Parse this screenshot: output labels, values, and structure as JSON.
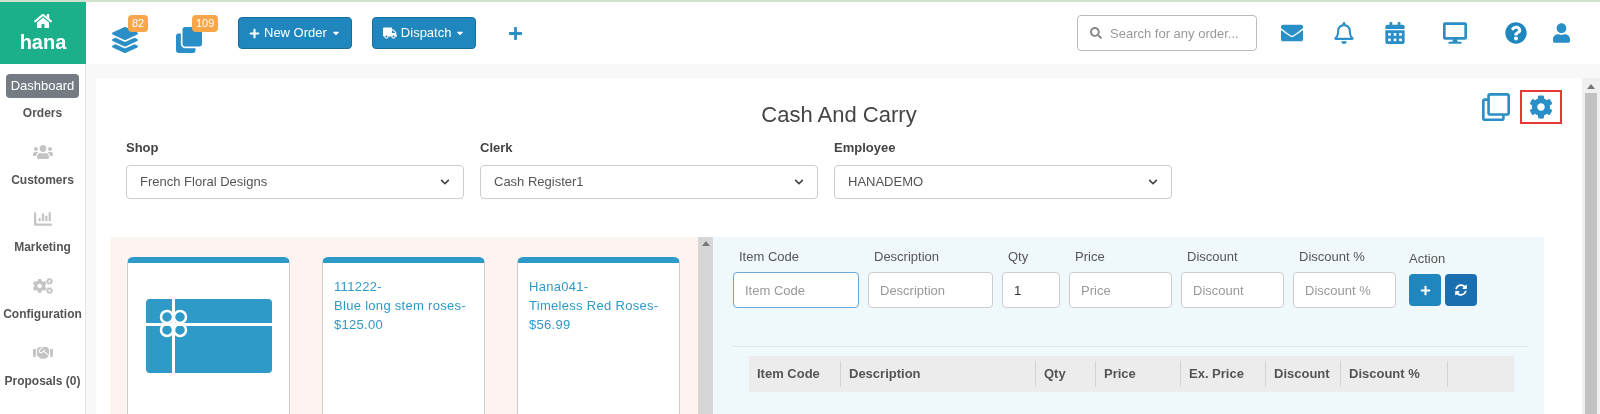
{
  "logo": {
    "text": "hana"
  },
  "tooltip": "Dashboard",
  "sidebar": {
    "items": [
      {
        "label": "Orders"
      },
      {
        "label": "Customers"
      },
      {
        "label": "Marketing"
      },
      {
        "label": "Configuration"
      },
      {
        "label": "Proposals (0)"
      }
    ]
  },
  "toolbar": {
    "badges": [
      "82",
      "109"
    ],
    "buttons": [
      "New Order",
      "Dispatch"
    ],
    "search": {
      "placeholder": "Search for any order..."
    }
  },
  "page": {
    "title": "Cash And Carry",
    "settings_highlighted": true,
    "selects": [
      {
        "label": "Shop",
        "value": "French Floral Designs"
      },
      {
        "label": "Clerk",
        "value": "Cash Register1"
      },
      {
        "label": "Employee",
        "value": "HANADEMO"
      }
    ]
  },
  "products": [
    {
      "kind": "picture"
    },
    {
      "kind": "text",
      "lines": [
        "111222-",
        "Blue long stem roses-",
        "$125.00"
      ]
    },
    {
      "kind": "text",
      "lines": [
        "Hana041-",
        "Timeless Red Roses-",
        "$56.99"
      ]
    }
  ],
  "entry": {
    "fields": [
      {
        "label": "Item Code",
        "placeholder": "Item Code",
        "focused": true
      },
      {
        "label": "Description",
        "placeholder": "Description",
        "focused": false
      },
      {
        "label": "Qty",
        "value": "1",
        "focused": false
      },
      {
        "label": "Price",
        "placeholder": "Price",
        "focused": false
      },
      {
        "label": "Discount",
        "placeholder": "Discount",
        "focused": false
      },
      {
        "label": "Discount %",
        "placeholder": "Discount %",
        "focused": false
      }
    ],
    "action_label": "Action"
  },
  "table": {
    "columns": [
      "Item Code",
      "Description",
      "Qty",
      "Price",
      "Ex. Price",
      "Discount",
      "Discount %"
    ]
  }
}
